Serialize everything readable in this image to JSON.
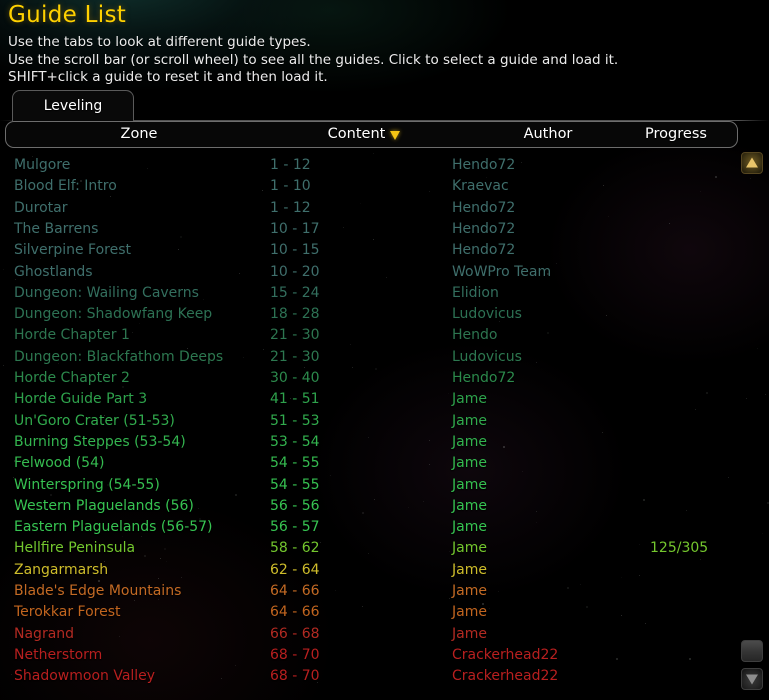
{
  "window": {
    "title": "Guide List",
    "instructions": [
      "Use the tabs to look at different guide types.",
      "Use the scroll bar (or scroll wheel) to see all the guides. Click to select a guide and load it.",
      "SHIFT+click a guide to reset it and then load it."
    ]
  },
  "tabs": [
    {
      "label": "Leveling",
      "selected": true
    }
  ],
  "columns": {
    "zone": "Zone",
    "content": "Content",
    "author": "Author",
    "progress": "Progress",
    "sorted_by": "Content",
    "sort_direction": "descending",
    "sort_icon": "chevron-down-icon"
  },
  "colors": {
    "title": "#ffd100",
    "sort_arrow": "#f4c414",
    "tier_trivial": "#3f6f6c",
    "tier_low": "#2f7a4a",
    "tier_green": "#2fa84f",
    "tier_bright_green": "#36c34f",
    "tier_yellow": "#d2c12c",
    "tier_orange": "#c96a22",
    "tier_red": "#b52222"
  },
  "rows": [
    {
      "zone": "Mulgore",
      "content": "1 - 12",
      "author": "Hendo72",
      "progress": "",
      "color": "#3f6f6c"
    },
    {
      "zone": "Blood Elf: Intro",
      "content": "1 - 10",
      "author": "Kraevac",
      "progress": "",
      "color": "#3f6f6c"
    },
    {
      "zone": "Durotar",
      "content": "1 - 12",
      "author": "Hendo72",
      "progress": "",
      "color": "#3f6f6c"
    },
    {
      "zone": "The Barrens",
      "content": "10 - 17",
      "author": "Hendo72",
      "progress": "",
      "color": "#3f6f6c"
    },
    {
      "zone": "Silverpine Forest",
      "content": "10 - 15",
      "author": "Hendo72",
      "progress": "",
      "color": "#3f6f6c"
    },
    {
      "zone": "Ghostlands",
      "content": "10 - 20",
      "author": "WoWPro Team",
      "progress": "",
      "color": "#3f6f6c"
    },
    {
      "zone": "Dungeon: Wailing Caverns",
      "content": "15 - 24",
      "author": "Elidion",
      "progress": "",
      "color": "#336f5e"
    },
    {
      "zone": "Dungeon: Shadowfang Keep",
      "content": "18 - 28",
      "author": "Ludovicus",
      "progress": "",
      "color": "#2d7254"
    },
    {
      "zone": "Horde Chapter 1",
      "content": "21 - 30",
      "author": "Hendo",
      "progress": "",
      "color": "#2d7550"
    },
    {
      "zone": "Dungeon: Blackfathom Deeps",
      "content": "21 - 30",
      "author": "Ludovicus",
      "progress": "",
      "color": "#2d7850"
    },
    {
      "zone": "Horde Chapter 2",
      "content": "30 - 40",
      "author": "Hendo72",
      "progress": "",
      "color": "#2c8a4c"
    },
    {
      "zone": "Horde Guide Part 3",
      "content": "41 - 51",
      "author": "Jame",
      "progress": "",
      "color": "#2ea24c"
    },
    {
      "zone": "Un'Goro Crater (51-53)",
      "content": "51 - 53",
      "author": "Jame",
      "progress": "",
      "color": "#31ab4d"
    },
    {
      "zone": "Burning Steppes (53-54)",
      "content": "53 - 54",
      "author": "Jame",
      "progress": "",
      "color": "#33b44f"
    },
    {
      "zone": "Felwood (54)",
      "content": "54 - 55",
      "author": "Jame",
      "progress": "",
      "color": "#35bb50"
    },
    {
      "zone": "Winterspring (54-55)",
      "content": "54 - 55",
      "author": "Jame",
      "progress": "",
      "color": "#36c051"
    },
    {
      "zone": "Western Plaguelands (56)",
      "content": "56 - 56",
      "author": "Jame",
      "progress": "",
      "color": "#37c452"
    },
    {
      "zone": "Eastern Plaguelands (56-57)",
      "content": "56 - 57",
      "author": "Jame",
      "progress": "",
      "color": "#37c452"
    },
    {
      "zone": "Hellfire Peninsula",
      "content": "58 - 62",
      "author": "Jame",
      "progress": "125/305",
      "color": "#74c72e"
    },
    {
      "zone": "Zangarmarsh",
      "content": "62 - 64",
      "author": "Jame",
      "progress": "",
      "color": "#cfbd2b"
    },
    {
      "zone": "Blade's Edge Mountains",
      "content": "64 - 66",
      "author": "Jame",
      "progress": "",
      "color": "#c46a24"
    },
    {
      "zone": "Terokkar Forest",
      "content": "64 - 66",
      "author": "Jame",
      "progress": "",
      "color": "#c2651f"
    },
    {
      "zone": "Nagrand",
      "content": "66 - 68",
      "author": "Jame",
      "progress": "",
      "color": "#b32a22"
    },
    {
      "zone": "Netherstorm",
      "content": "68 - 70",
      "author": "Crackerhead22",
      "progress": "",
      "color": "#b81f1f"
    },
    {
      "zone": "Shadowmoon Valley",
      "content": "68 - 70",
      "author": "Crackerhead22",
      "progress": "",
      "color": "#b81f1f"
    }
  ],
  "scrollbar": {
    "up_icon": "scroll-up-arrow-icon",
    "down_icon": "scroll-down-arrow-icon",
    "thumb": "scrollbar-thumb"
  }
}
